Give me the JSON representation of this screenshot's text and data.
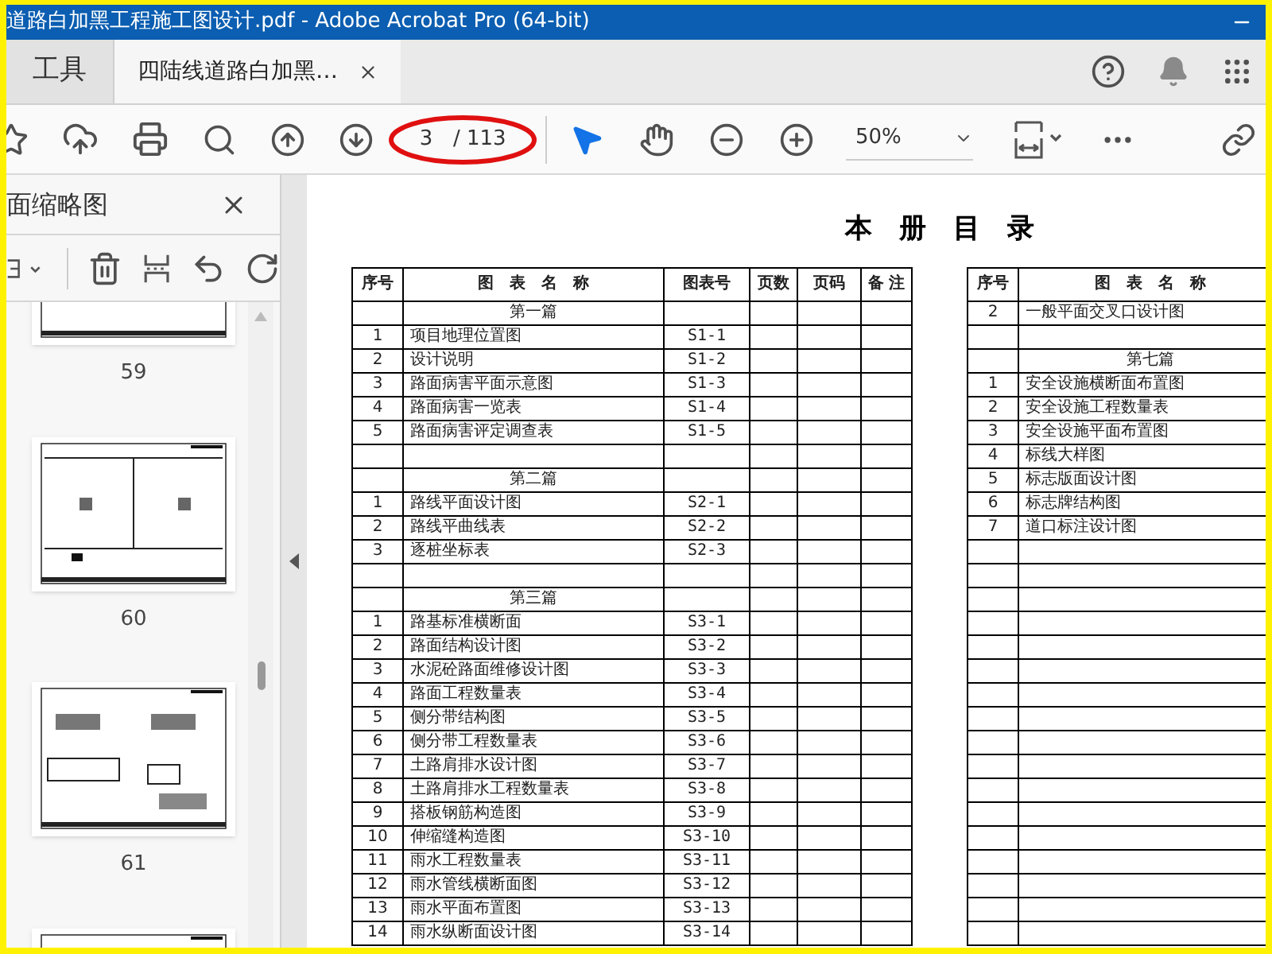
{
  "window": {
    "title": "道路白加黑工程施工图设计.pdf - Adobe Acrobat Pro (64-bit)"
  },
  "tabs": [
    {
      "label": "工具",
      "selected": false
    },
    {
      "label": "四陆线道路白加黑…",
      "selected": true
    }
  ],
  "toolbar": {
    "page": {
      "value": "3",
      "total": "/ 113"
    },
    "zoom": "50%"
  },
  "sidebar": {
    "title": "面缩略图",
    "thumbnails": [
      {
        "kind": "page",
        "label": "59"
      },
      {
        "kind": "page",
        "label": "60"
      },
      {
        "kind": "page",
        "label": "61"
      },
      {
        "kind": "page"
      }
    ]
  },
  "document": {
    "title": "本　册　目　录",
    "left_table": {
      "columns": [
        "序号",
        "图　表　名　称",
        "图表号",
        "页数",
        "页码",
        "备 注"
      ],
      "rows": [
        {
          "kind": "section",
          "name": "第一篇"
        },
        {
          "kind": "item",
          "no": "1",
          "name": "项目地理位置图",
          "code": "S1-1"
        },
        {
          "kind": "item",
          "no": "2",
          "name": "设计说明",
          "code": "S1-2"
        },
        {
          "kind": "item",
          "no": "3",
          "name": "路面病害平面示意图",
          "code": "S1-3"
        },
        {
          "kind": "item",
          "no": "4",
          "name": "路面病害一览表",
          "code": "S1-4"
        },
        {
          "kind": "item",
          "no": "5",
          "name": "路面病害评定调查表",
          "code": "S1-5"
        },
        {
          "kind": "blank"
        },
        {
          "kind": "section",
          "name": "第二篇"
        },
        {
          "kind": "item",
          "no": "1",
          "name": "路线平面设计图",
          "code": "S2-1"
        },
        {
          "kind": "item",
          "no": "2",
          "name": "路线平曲线表",
          "code": "S2-2"
        },
        {
          "kind": "item",
          "no": "3",
          "name": "逐桩坐标表",
          "code": "S2-3"
        },
        {
          "kind": "blank"
        },
        {
          "kind": "section",
          "name": "第三篇"
        },
        {
          "kind": "item",
          "no": "1",
          "name": "路基标准横断面",
          "code": "S3-1"
        },
        {
          "kind": "item",
          "no": "2",
          "name": "路面结构设计图",
          "code": "S3-2"
        },
        {
          "kind": "item",
          "no": "3",
          "name": "水泥砼路面维修设计图",
          "code": "S3-3"
        },
        {
          "kind": "item",
          "no": "4",
          "name": "路面工程数量表",
          "code": "S3-4"
        },
        {
          "kind": "item",
          "no": "5",
          "name": "侧分带结构图",
          "code": "S3-5"
        },
        {
          "kind": "item",
          "no": "6",
          "name": "侧分带工程数量表",
          "code": "S3-6"
        },
        {
          "kind": "item",
          "no": "7",
          "name": "土路肩排水设计图",
          "code": "S3-7"
        },
        {
          "kind": "item",
          "no": "8",
          "name": "土路肩排水工程数量表",
          "code": "S3-8"
        },
        {
          "kind": "item",
          "no": "9",
          "name": "搭板钢筋构造图",
          "code": "S3-9"
        },
        {
          "kind": "item",
          "no": "10",
          "name": "伸缩缝构造图",
          "code": "S3-10"
        },
        {
          "kind": "item",
          "no": "11",
          "name": "雨水工程数量表",
          "code": "S3-11"
        },
        {
          "kind": "item",
          "no": "12",
          "name": "雨水管线横断面图",
          "code": "S3-12"
        },
        {
          "kind": "item",
          "no": "13",
          "name": "雨水平面布置图",
          "code": "S3-13"
        },
        {
          "kind": "item",
          "no": "14",
          "name": "雨水纵断面设计图",
          "code": "S3-14"
        }
      ]
    },
    "right_table": {
      "columns": [
        "序号",
        "图　表　名　称"
      ],
      "rows": [
        {
          "kind": "item",
          "no": "2",
          "name": "一般平面交叉口设计图"
        },
        {
          "kind": "blank"
        },
        {
          "kind": "section",
          "name": "第七篇"
        },
        {
          "kind": "item",
          "no": "1",
          "name": "安全设施横断面布置图"
        },
        {
          "kind": "item",
          "no": "2",
          "name": "安全设施工程数量表"
        },
        {
          "kind": "item",
          "no": "3",
          "name": "安全设施平面布置图"
        },
        {
          "kind": "item",
          "no": "4",
          "name": "标线大样图"
        },
        {
          "kind": "item",
          "no": "5",
          "name": "标志版面设计图"
        },
        {
          "kind": "item",
          "no": "6",
          "name": "标志牌结构图"
        },
        {
          "kind": "item",
          "no": "7",
          "name": "道口标注设计图"
        },
        {
          "kind": "blank"
        },
        {
          "kind": "blank"
        },
        {
          "kind": "blank"
        },
        {
          "kind": "blank"
        },
        {
          "kind": "blank"
        },
        {
          "kind": "blank"
        },
        {
          "kind": "blank"
        },
        {
          "kind": "blank"
        },
        {
          "kind": "blank"
        },
        {
          "kind": "blank"
        },
        {
          "kind": "blank"
        },
        {
          "kind": "blank"
        },
        {
          "kind": "blank"
        },
        {
          "kind": "blank"
        },
        {
          "kind": "blank"
        },
        {
          "kind": "blank"
        },
        {
          "kind": "blank"
        }
      ]
    }
  }
}
